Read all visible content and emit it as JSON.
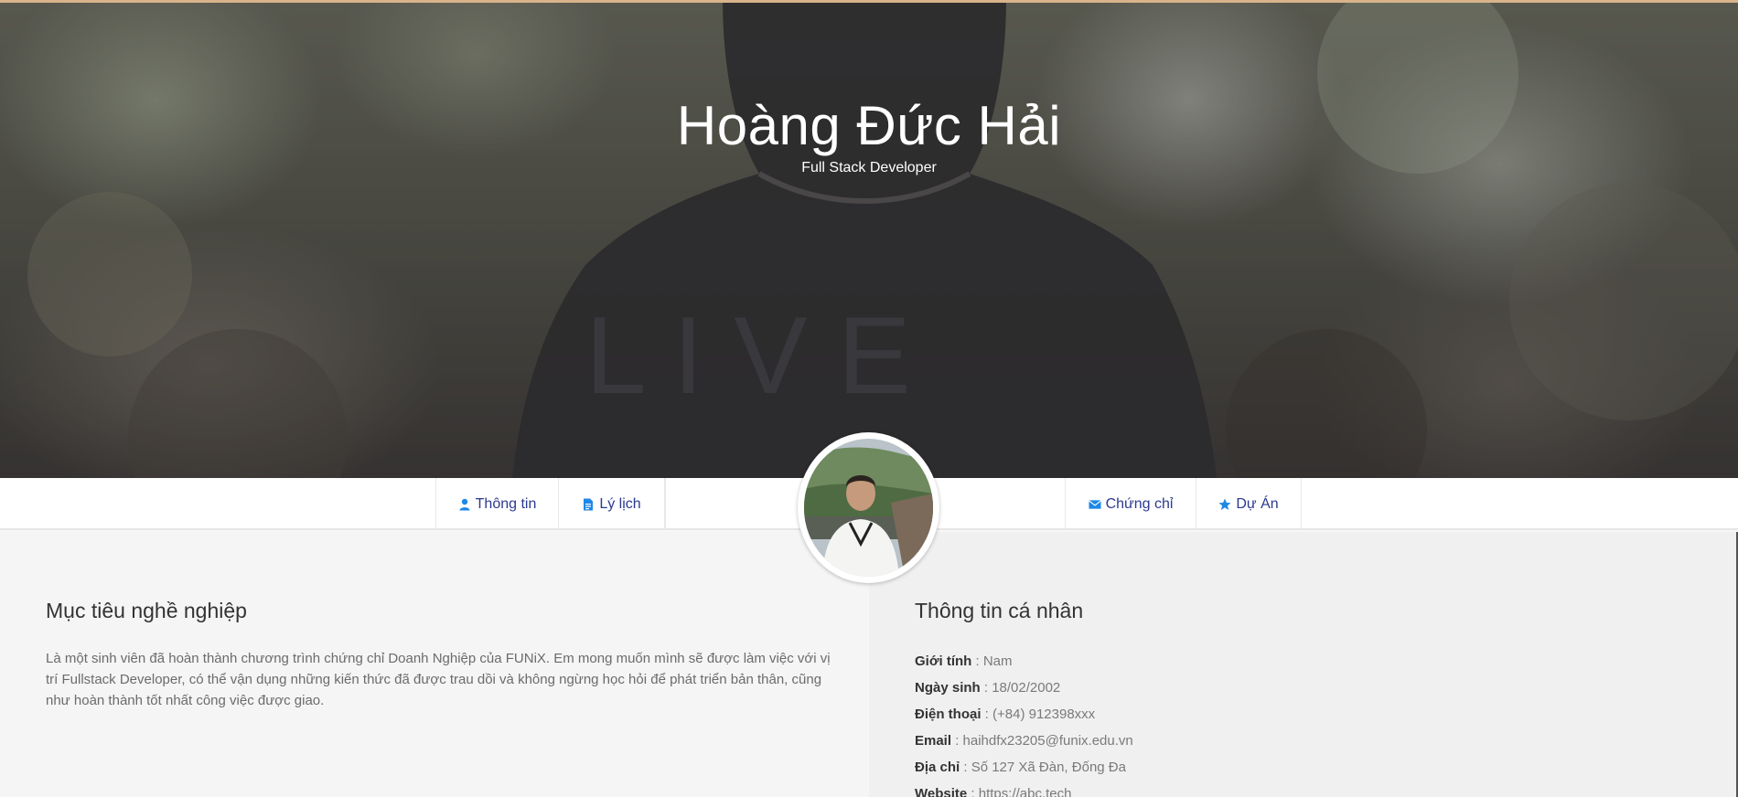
{
  "hero": {
    "name": "Hoàng Đức Hải",
    "role": "Full Stack Developer"
  },
  "nav": {
    "items": [
      {
        "label": "Thông tin",
        "icon": "user-icon"
      },
      {
        "label": "Lý lịch",
        "icon": "file-icon"
      },
      {
        "label": "Chứng chỉ",
        "icon": "envelope-icon"
      },
      {
        "label": "Dự Án",
        "icon": "star-icon"
      }
    ]
  },
  "career": {
    "title": "Mục tiêu nghề nghiệp",
    "text": "Là một sinh viên đã hoàn thành chương trình chứng chỉ Doanh Nghiệp của FUNiX. Em mong muốn mình sẽ được làm việc với vị trí Fullstack Developer, có thể vận dụng những kiến thức đã được trau dồi và không ngừng học hỏi để phát triển bản thân, cũng như hoàn thành tốt nhất công việc được giao."
  },
  "personal": {
    "title": "Thông tin cá nhân",
    "rows": [
      {
        "label": "Giới tính",
        "value": " : Nam"
      },
      {
        "label": "Ngày sinh",
        "value": " : 18/02/2002"
      },
      {
        "label": "Điện thoại",
        "value": " : (+84) 912398xxx"
      },
      {
        "label": "Email",
        "value": " : haihdfx23205@funix.edu.vn"
      },
      {
        "label": "Địa chỉ",
        "value": " : Số 127 Xã Đàn, Đống Đa"
      },
      {
        "label": "Website",
        "value": " : https://abc.tech"
      }
    ]
  },
  "colors": {
    "nav_text": "#2b3a8f",
    "icon_blue": "#1e88e5",
    "heading": "#333333",
    "body_text": "#6b6b6b"
  }
}
